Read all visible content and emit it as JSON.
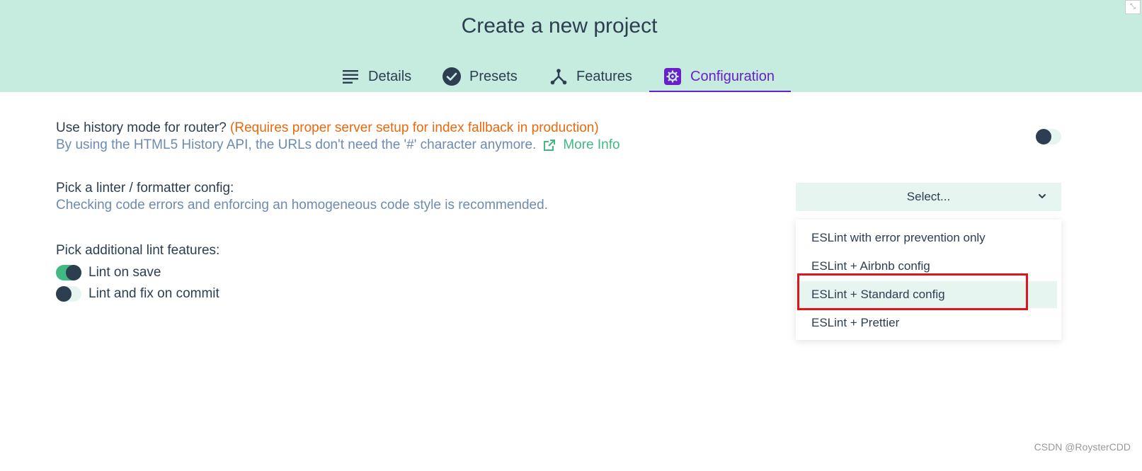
{
  "header": {
    "title": "Create a new project",
    "tabs": [
      {
        "label": "Details",
        "icon": "list-icon"
      },
      {
        "label": "Presets",
        "icon": "check-circle-icon"
      },
      {
        "label": "Features",
        "icon": "fork-icon"
      },
      {
        "label": "Configuration",
        "icon": "gear-icon",
        "active": true
      }
    ]
  },
  "history": {
    "label": "Use history mode for router?",
    "warning": "(Requires proper server setup for index fallback in production)",
    "description": "By using the HTML5 History API, the URLs don't need the '#' character anymore.",
    "more_info": "More Info",
    "enabled": false
  },
  "linter": {
    "label": "Pick a linter / formatter config:",
    "description": "Checking code errors and enforcing an homogeneous code style is recommended.",
    "select_value": "Select...",
    "options": [
      "ESLint with error prevention only",
      "ESLint + Airbnb config",
      "ESLint + Standard config",
      "ESLint + Prettier"
    ],
    "highlighted_index": 2
  },
  "lint_features": {
    "label": "Pick additional lint features:",
    "items": [
      {
        "label": "Lint on save",
        "enabled": true
      },
      {
        "label": "Lint and fix on commit",
        "enabled": false
      }
    ]
  },
  "watermark": "CSDN @RoysterCDD",
  "colors": {
    "header_bg": "#c6ebdf",
    "accent": "#6a1fc9",
    "green": "#42b983",
    "warning": "#e8690e",
    "highlight_box": "#e0141c"
  }
}
